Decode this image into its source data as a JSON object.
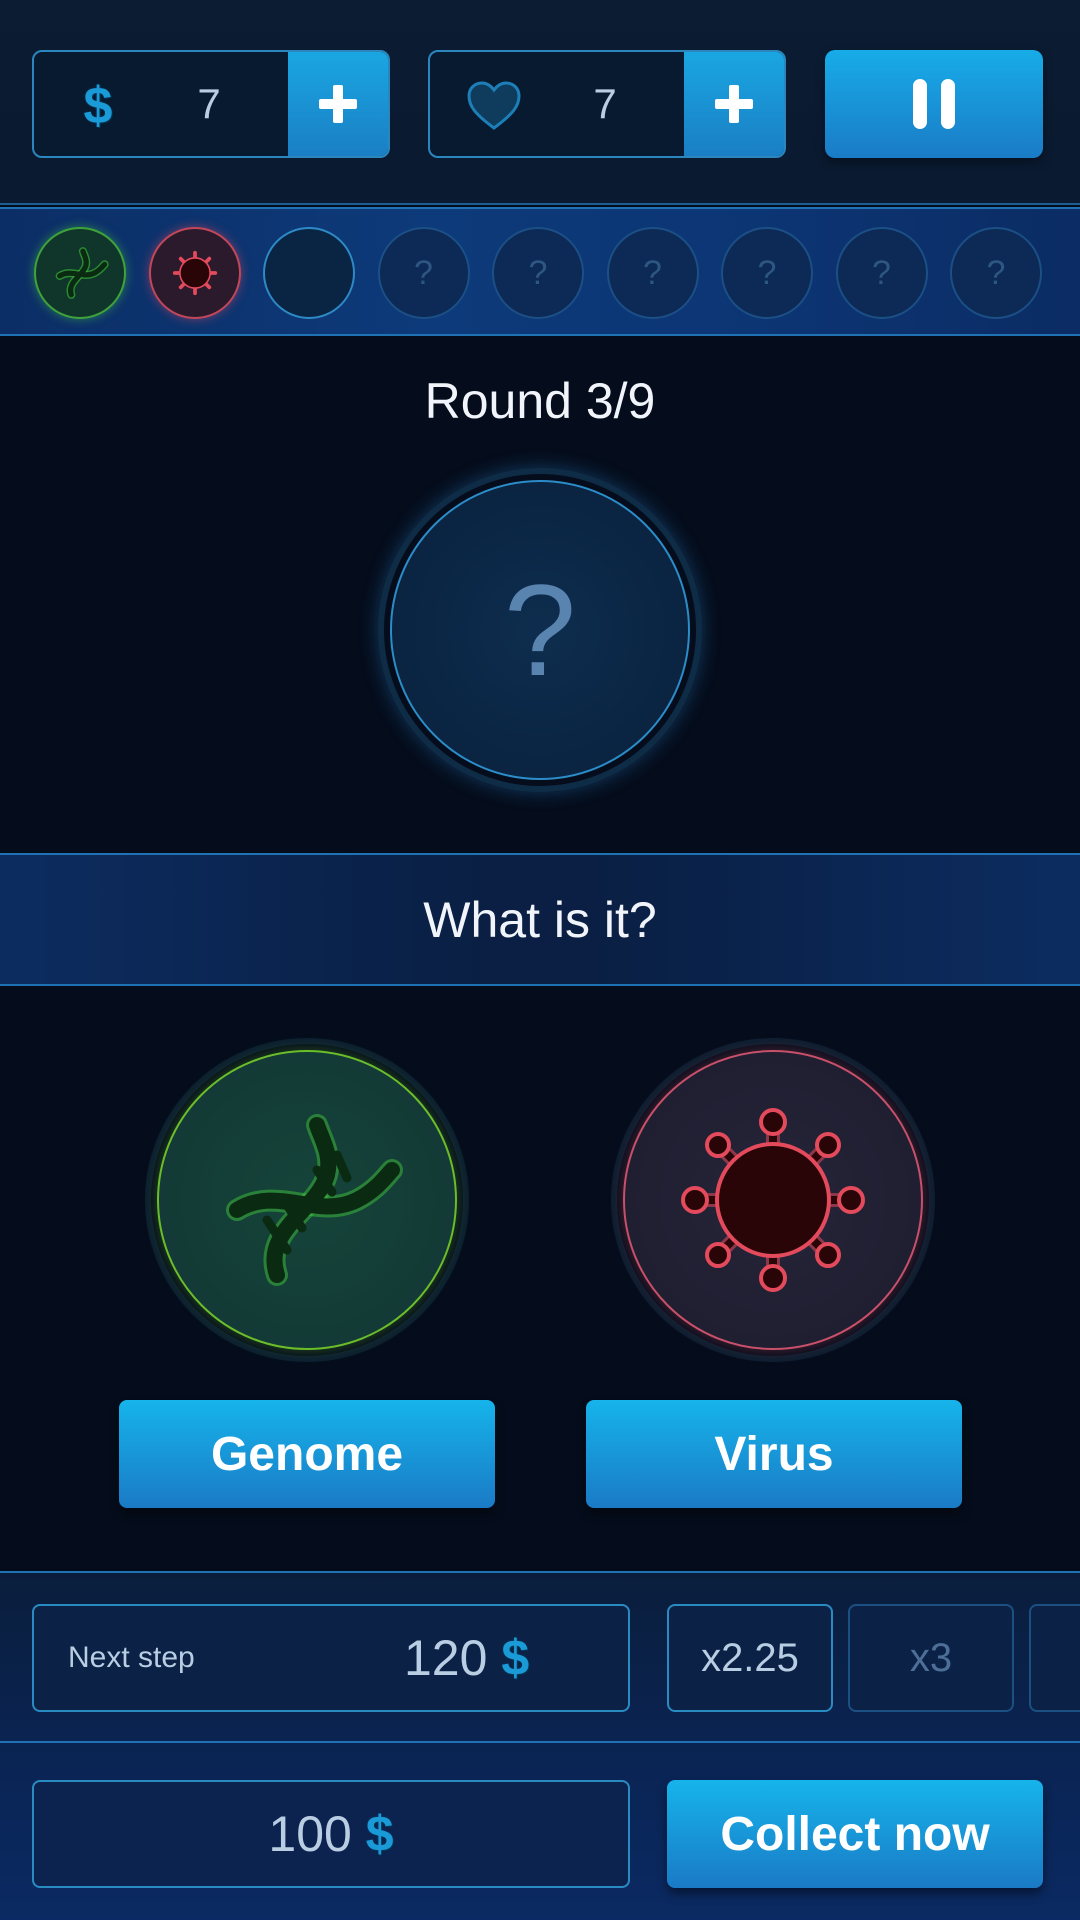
{
  "hud": {
    "coins": "7",
    "coins_icon": "dollar-icon",
    "lives": "7",
    "lives_icon": "heart-icon",
    "add_icon": "plus-icon",
    "pause_icon": "pause-icon"
  },
  "progress": {
    "slots": [
      {
        "state": "genome",
        "label": ""
      },
      {
        "state": "virus",
        "label": ""
      },
      {
        "state": "current",
        "label": ""
      },
      {
        "state": "locked",
        "label": "?"
      },
      {
        "state": "locked",
        "label": "?"
      },
      {
        "state": "locked",
        "label": "?"
      },
      {
        "state": "locked",
        "label": "?"
      },
      {
        "state": "locked",
        "label": "?"
      },
      {
        "state": "locked",
        "label": "?"
      }
    ]
  },
  "round": {
    "title": "Round 3/9",
    "mystery_symbol": "?"
  },
  "question": "What is it?",
  "choices": {
    "genome": {
      "label": "Genome",
      "icon": "dna-icon",
      "color": "#6bbd2a"
    },
    "virus": {
      "label": "Virus",
      "icon": "virus-icon",
      "color": "#e34a5c"
    }
  },
  "rewards": {
    "next_step_label": "Next step",
    "next_step_amount": "120",
    "currency_symbol": "$",
    "multipliers": [
      "x2.25",
      "x3"
    ],
    "bank_amount": "100",
    "collect_label": "Collect now"
  },
  "colors": {
    "accent": "#1a9bd8",
    "button": "#1a7ac6",
    "background": "#050d1c"
  }
}
